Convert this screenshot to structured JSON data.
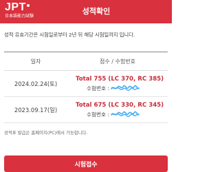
{
  "header": {
    "logo_text": "JPT",
    "logo_subtitle": "日本語能力試験",
    "title": "성적확인"
  },
  "notice": "성적 유효기간은 시험일로부터 2년 뒤 해당 시험일까지 입니다.",
  "table": {
    "columns": [
      "일자",
      "점수 / 수험번호"
    ],
    "rows": [
      {
        "date": "2024.02.24(토)",
        "total": "Total 755 (LC 370, RC 385)",
        "exam_label": "수험번호 :"
      },
      {
        "date": "2023.09.17(일)",
        "total": "Total 675 (LC 330, RC 345)",
        "exam_label": "수험번호 :"
      }
    ]
  },
  "footnote": "성적표 발급은 홈페이지(PC)에서 가능합니다.",
  "button_label": "시험접수",
  "colors": {
    "brand_red": "#d9313d",
    "score_red": "#c62c3a",
    "redaction_blue": "#3fa9f5"
  }
}
